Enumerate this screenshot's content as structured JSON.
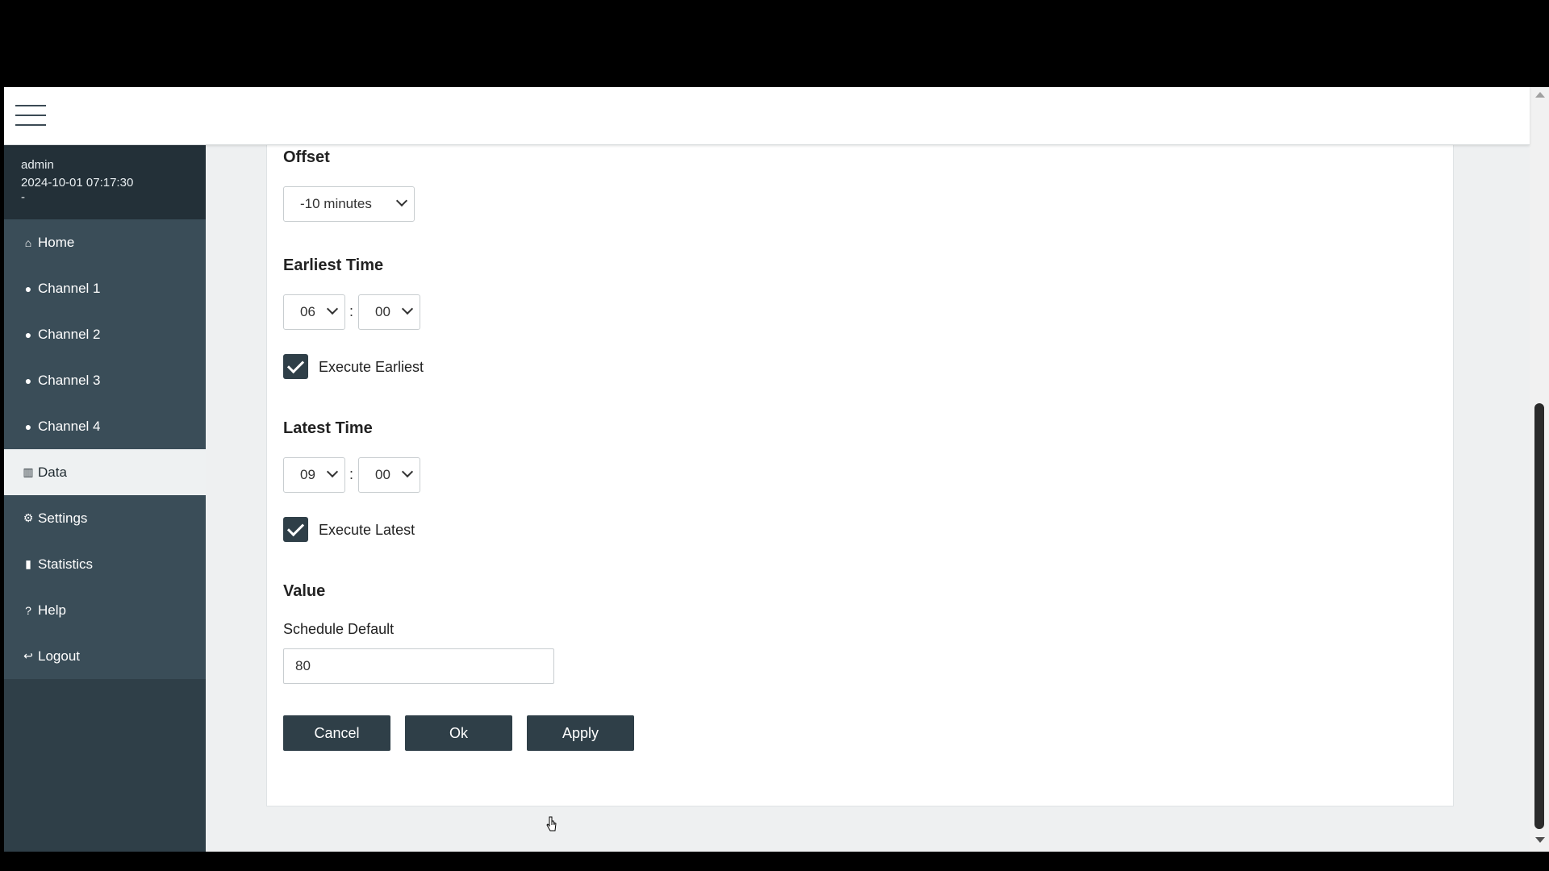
{
  "user": {
    "name": "admin",
    "datetime": "2024-10-01 07:17:30",
    "extra": "-"
  },
  "nav": [
    {
      "label": "Home",
      "icon": "home-icon",
      "glyph": "⌂"
    },
    {
      "label": "Channel 1",
      "icon": "bulb-icon",
      "glyph": "💡"
    },
    {
      "label": "Channel 2",
      "icon": "bulb-icon",
      "glyph": "💡"
    },
    {
      "label": "Channel 3",
      "icon": "bulb-icon",
      "glyph": "💡"
    },
    {
      "label": "Channel 4",
      "icon": "bulb-icon",
      "glyph": "💡"
    },
    {
      "label": "Data",
      "icon": "chart-icon",
      "glyph": "▥",
      "active": true
    },
    {
      "label": "Settings",
      "icon": "gear-icon",
      "glyph": "⚙"
    },
    {
      "label": "Statistics",
      "icon": "document-icon",
      "glyph": "▮"
    },
    {
      "label": "Help",
      "icon": "help-icon",
      "glyph": "?"
    },
    {
      "label": "Logout",
      "icon": "logout-icon",
      "glyph": "↩"
    }
  ],
  "form": {
    "offset": {
      "label": "Offset",
      "value": "-10 minutes"
    },
    "earliest": {
      "label": "Earliest Time",
      "hour": "06",
      "minute": "00",
      "separator": ":",
      "execute_label": "Execute Earliest",
      "execute_checked": true
    },
    "latest": {
      "label": "Latest Time",
      "hour": "09",
      "minute": "00",
      "separator": ":",
      "execute_label": "Execute Latest",
      "execute_checked": true
    },
    "value": {
      "label": "Value",
      "field_label": "Schedule Default",
      "field_value": "80"
    },
    "buttons": {
      "cancel": "Cancel",
      "ok": "Ok",
      "apply": "Apply"
    }
  },
  "colors": {
    "sidebar": "#2f3f48",
    "nav_item": "#3a4d58",
    "accent_button": "#2f3f48",
    "background": "#eef0f1"
  }
}
